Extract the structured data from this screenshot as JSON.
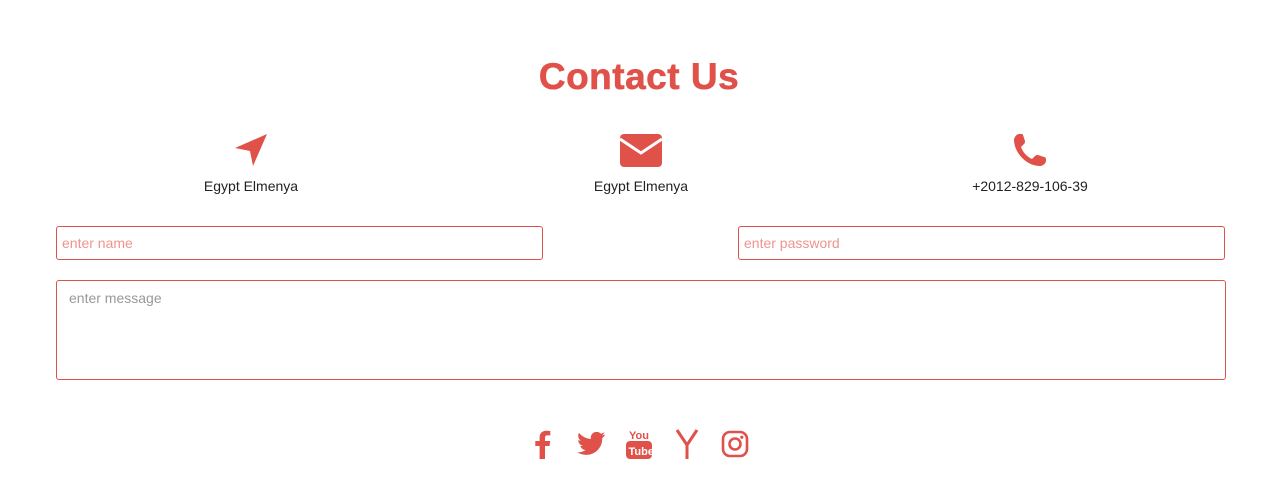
{
  "colors": {
    "accent": "#e0514a",
    "input_placeholder": "#f0938d",
    "message_placeholder": "#999999",
    "text": "#222222"
  },
  "header": {
    "title": "Contact Us"
  },
  "contact_info": [
    {
      "icon": "location-arrow-icon",
      "text": "Egypt Elmenya"
    },
    {
      "icon": "envelope-icon",
      "text": "Egypt Elmenya"
    },
    {
      "icon": "phone-icon",
      "text": "+2012-829-106-39"
    }
  ],
  "form": {
    "name_placeholder": "enter name",
    "password_placeholder": "enter password",
    "message_placeholder": "enter message"
  },
  "social": [
    {
      "icon": "facebook-icon"
    },
    {
      "icon": "twitter-icon"
    },
    {
      "icon": "youtube-icon",
      "text": "You Tube"
    },
    {
      "icon": "y-combinator-icon"
    },
    {
      "icon": "instagram-icon"
    }
  ]
}
